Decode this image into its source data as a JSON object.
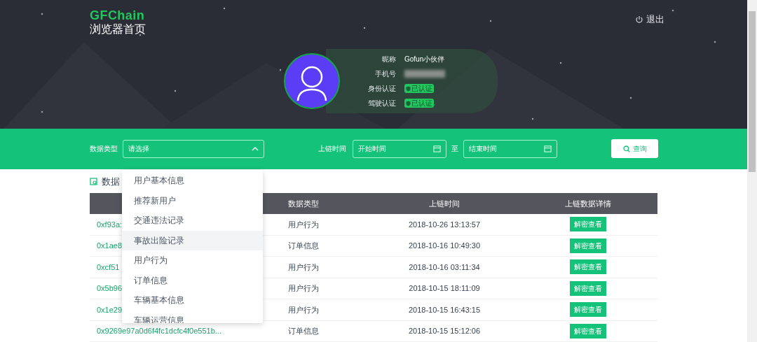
{
  "header": {
    "logo": "GFChain",
    "subtitle": "浏览器首页",
    "logout": "退出"
  },
  "profile": {
    "fields": [
      {
        "kind": "text",
        "label": "昵称",
        "value": "Gofun小伙伴"
      },
      {
        "kind": "hidden",
        "label": "手机号"
      },
      {
        "kind": "badge",
        "label": "身份认证",
        "value": "已认证"
      },
      {
        "kind": "badge",
        "label": "驾驶认证",
        "value": "已认证"
      }
    ]
  },
  "filters": {
    "type_label": "数据类型",
    "type_placeholder": "请选择",
    "dropdown_expanded": true,
    "time_label": "上链时间",
    "start_placeholder": "开始时间",
    "separator": "至",
    "end_placeholder": "结束时间",
    "search_button": "查询"
  },
  "dropdown": [
    {
      "label": "用户基本信息",
      "highlighted": false
    },
    {
      "label": "推荐新用户",
      "highlighted": false
    },
    {
      "label": "交通违法记录",
      "highlighted": false
    },
    {
      "label": "事故出险记录",
      "highlighted": true
    },
    {
      "label": "用户行为",
      "highlighted": false
    },
    {
      "label": "订单信息",
      "highlighted": false
    },
    {
      "label": "车辆基本信息",
      "highlighted": false
    },
    {
      "label": "车辆运营信息",
      "highlighted": false
    }
  ],
  "section_title": "数据",
  "table": {
    "columns": [
      "数据类型",
      "上链时间",
      "上链数据详情"
    ],
    "rows": [
      {
        "hash": "0xf93a:",
        "type": "用户行为",
        "time": "2018-10-26 13:13:57",
        "action": "解密查看"
      },
      {
        "hash": "0x1ae8",
        "type": "订单信息",
        "time": "2018-10-16 10:49:30",
        "action": "解密查看"
      },
      {
        "hash": "0xcf51",
        "type": "用户行为",
        "time": "2018-10-16 03:11:34",
        "action": "解密查看"
      },
      {
        "hash": "0x5b96",
        "type": "用户行为",
        "time": "2018-10-15 18:11:09",
        "action": "解密查看"
      },
      {
        "hash": "0x1e29",
        "type": "用户行为",
        "time": "2018-10-15 16:43:15",
        "action": "解密查看"
      },
      {
        "hash": "0x9269e97a0d6f4fc1dcfc4f0e551b...",
        "type": "订单信息",
        "time": "2018-10-15 15:12:06",
        "action": "解密查看"
      }
    ]
  }
}
